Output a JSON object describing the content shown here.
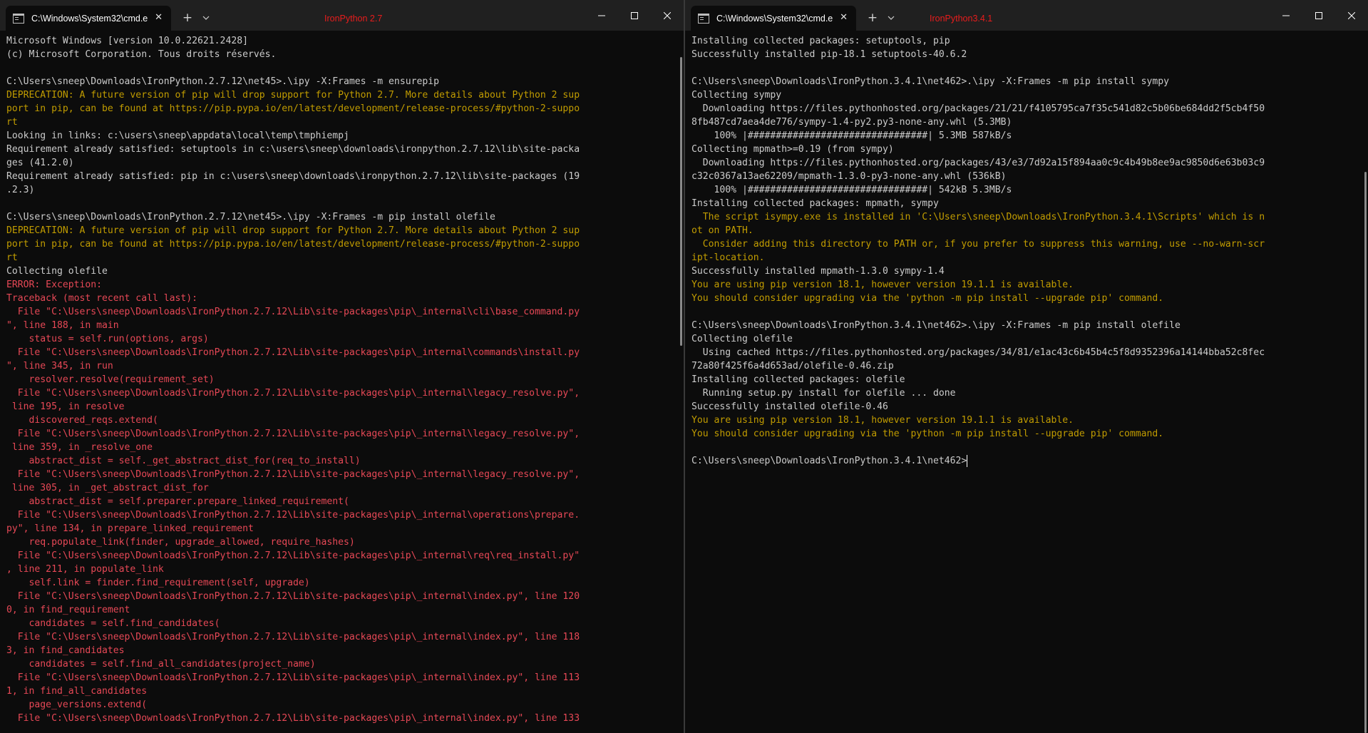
{
  "left_window": {
    "tab_title": "C:\\Windows\\System32\\cmd.e",
    "annotation": "IronPython 2.7",
    "lines": [
      {
        "t": "Microsoft Windows [version 10.0.22621.2428]",
        "c": "normal"
      },
      {
        "t": "(c) Microsoft Corporation. Tous droits réservés.",
        "c": "normal"
      },
      {
        "t": "",
        "c": "normal"
      },
      {
        "t": "C:\\Users\\sneep\\Downloads\\IronPython.2.7.12\\net45>.\\ipy -X:Frames -m ensurepip",
        "c": "normal"
      },
      {
        "t": "DEPRECATION: A future version of pip will drop support for Python 2.7. More details about Python 2 sup",
        "c": "warn"
      },
      {
        "t": "port in pip, can be found at https://pip.pypa.io/en/latest/development/release-process/#python-2-suppo",
        "c": "warn"
      },
      {
        "t": "rt",
        "c": "warn"
      },
      {
        "t": "Looking in links: c:\\users\\sneep\\appdata\\local\\temp\\tmphiempj",
        "c": "normal"
      },
      {
        "t": "Requirement already satisfied: setuptools in c:\\users\\sneep\\downloads\\ironpython.2.7.12\\lib\\site-packa",
        "c": "normal"
      },
      {
        "t": "ges (41.2.0)",
        "c": "normal"
      },
      {
        "t": "Requirement already satisfied: pip in c:\\users\\sneep\\downloads\\ironpython.2.7.12\\lib\\site-packages (19",
        "c": "normal"
      },
      {
        "t": ".2.3)",
        "c": "normal"
      },
      {
        "t": "",
        "c": "normal"
      },
      {
        "t": "C:\\Users\\sneep\\Downloads\\IronPython.2.7.12\\net45>.\\ipy -X:Frames -m pip install olefile",
        "c": "normal"
      },
      {
        "t": "DEPRECATION: A future version of pip will drop support for Python 2.7. More details about Python 2 sup",
        "c": "warn"
      },
      {
        "t": "port in pip, can be found at https://pip.pypa.io/en/latest/development/release-process/#python-2-suppo",
        "c": "warn"
      },
      {
        "t": "rt",
        "c": "warn"
      },
      {
        "t": "Collecting olefile",
        "c": "normal"
      },
      {
        "t": "ERROR: Exception:",
        "c": "err"
      },
      {
        "t": "Traceback (most recent call last):",
        "c": "err"
      },
      {
        "t": "  File \"C:\\Users\\sneep\\Downloads\\IronPython.2.7.12\\Lib\\site-packages\\pip\\_internal\\cli\\base_command.py",
        "c": "err"
      },
      {
        "t": "\", line 188, in main",
        "c": "err"
      },
      {
        "t": "    status = self.run(options, args)",
        "c": "err"
      },
      {
        "t": "  File \"C:\\Users\\sneep\\Downloads\\IronPython.2.7.12\\Lib\\site-packages\\pip\\_internal\\commands\\install.py",
        "c": "err"
      },
      {
        "t": "\", line 345, in run",
        "c": "err"
      },
      {
        "t": "    resolver.resolve(requirement_set)",
        "c": "err"
      },
      {
        "t": "  File \"C:\\Users\\sneep\\Downloads\\IronPython.2.7.12\\Lib\\site-packages\\pip\\_internal\\legacy_resolve.py\",",
        "c": "err"
      },
      {
        "t": " line 195, in resolve",
        "c": "err"
      },
      {
        "t": "    discovered_reqs.extend(",
        "c": "err"
      },
      {
        "t": "  File \"C:\\Users\\sneep\\Downloads\\IronPython.2.7.12\\Lib\\site-packages\\pip\\_internal\\legacy_resolve.py\",",
        "c": "err"
      },
      {
        "t": " line 359, in _resolve_one",
        "c": "err"
      },
      {
        "t": "    abstract_dist = self._get_abstract_dist_for(req_to_install)",
        "c": "err"
      },
      {
        "t": "  File \"C:\\Users\\sneep\\Downloads\\IronPython.2.7.12\\Lib\\site-packages\\pip\\_internal\\legacy_resolve.py\",",
        "c": "err"
      },
      {
        "t": " line 305, in _get_abstract_dist_for",
        "c": "err"
      },
      {
        "t": "    abstract_dist = self.preparer.prepare_linked_requirement(",
        "c": "err"
      },
      {
        "t": "  File \"C:\\Users\\sneep\\Downloads\\IronPython.2.7.12\\Lib\\site-packages\\pip\\_internal\\operations\\prepare.",
        "c": "err"
      },
      {
        "t": "py\", line 134, in prepare_linked_requirement",
        "c": "err"
      },
      {
        "t": "    req.populate_link(finder, upgrade_allowed, require_hashes)",
        "c": "err"
      },
      {
        "t": "  File \"C:\\Users\\sneep\\Downloads\\IronPython.2.7.12\\Lib\\site-packages\\pip\\_internal\\req\\req_install.py\"",
        "c": "err"
      },
      {
        "t": ", line 211, in populate_link",
        "c": "err"
      },
      {
        "t": "    self.link = finder.find_requirement(self, upgrade)",
        "c": "err"
      },
      {
        "t": "  File \"C:\\Users\\sneep\\Downloads\\IronPython.2.7.12\\Lib\\site-packages\\pip\\_internal\\index.py\", line 120",
        "c": "err"
      },
      {
        "t": "0, in find_requirement",
        "c": "err"
      },
      {
        "t": "    candidates = self.find_candidates(",
        "c": "err"
      },
      {
        "t": "  File \"C:\\Users\\sneep\\Downloads\\IronPython.2.7.12\\Lib\\site-packages\\pip\\_internal\\index.py\", line 118",
        "c": "err"
      },
      {
        "t": "3, in find_candidates",
        "c": "err"
      },
      {
        "t": "    candidates = self.find_all_candidates(project_name)",
        "c": "err"
      },
      {
        "t": "  File \"C:\\Users\\sneep\\Downloads\\IronPython.2.7.12\\Lib\\site-packages\\pip\\_internal\\index.py\", line 113",
        "c": "err"
      },
      {
        "t": "1, in find_all_candidates",
        "c": "err"
      },
      {
        "t": "    page_versions.extend(",
        "c": "err"
      },
      {
        "t": "  File \"C:\\Users\\sneep\\Downloads\\IronPython.2.7.12\\Lib\\site-packages\\pip\\_internal\\index.py\", line 133",
        "c": "err"
      }
    ]
  },
  "right_window": {
    "tab_title": "C:\\Windows\\System32\\cmd.e",
    "annotation": "IronPython3.4.1",
    "lines": [
      {
        "t": "Installing collected packages: setuptools, pip",
        "c": "normal"
      },
      {
        "t": "Successfully installed pip-18.1 setuptools-40.6.2",
        "c": "normal"
      },
      {
        "t": "",
        "c": "normal"
      },
      {
        "t": "C:\\Users\\sneep\\Downloads\\IronPython.3.4.1\\net462>.\\ipy -X:Frames -m pip install sympy",
        "c": "normal"
      },
      {
        "t": "Collecting sympy",
        "c": "normal"
      },
      {
        "t": "  Downloading https://files.pythonhosted.org/packages/21/21/f4105795ca7f35c541d82c5b06be684dd2f5cb4f50",
        "c": "normal"
      },
      {
        "t": "8fb487cd7aea4de776/sympy-1.4-py2.py3-none-any.whl (5.3MB)",
        "c": "normal"
      },
      {
        "t": "    100% |################################| 5.3MB 587kB/s",
        "c": "normal"
      },
      {
        "t": "Collecting mpmath>=0.19 (from sympy)",
        "c": "normal"
      },
      {
        "t": "  Downloading https://files.pythonhosted.org/packages/43/e3/7d92a15f894aa0c9c4b49b8ee9ac9850d6e63b03c9",
        "c": "normal"
      },
      {
        "t": "c32c0367a13ae62209/mpmath-1.3.0-py3-none-any.whl (536kB)",
        "c": "normal"
      },
      {
        "t": "    100% |################################| 542kB 5.3MB/s",
        "c": "normal"
      },
      {
        "t": "Installing collected packages: mpmath, sympy",
        "c": "normal"
      },
      {
        "t": "  The script isympy.exe is installed in 'C:\\Users\\sneep\\Downloads\\IronPython.3.4.1\\Scripts' which is n",
        "c": "warn"
      },
      {
        "t": "ot on PATH.",
        "c": "warn"
      },
      {
        "t": "  Consider adding this directory to PATH or, if you prefer to suppress this warning, use --no-warn-scr",
        "c": "warn"
      },
      {
        "t": "ipt-location.",
        "c": "warn"
      },
      {
        "t": "Successfully installed mpmath-1.3.0 sympy-1.4",
        "c": "normal"
      },
      {
        "t": "You are using pip version 18.1, however version 19.1.1 is available.",
        "c": "warn"
      },
      {
        "t": "You should consider upgrading via the 'python -m pip install --upgrade pip' command.",
        "c": "warn"
      },
      {
        "t": "",
        "c": "normal"
      },
      {
        "t": "C:\\Users\\sneep\\Downloads\\IronPython.3.4.1\\net462>.\\ipy -X:Frames -m pip install olefile",
        "c": "normal"
      },
      {
        "t": "Collecting olefile",
        "c": "normal"
      },
      {
        "t": "  Using cached https://files.pythonhosted.org/packages/34/81/e1ac43c6b45b4c5f8d9352396a14144bba52c8fec",
        "c": "normal"
      },
      {
        "t": "72a80f425f6a4d653ad/olefile-0.46.zip",
        "c": "normal"
      },
      {
        "t": "Installing collected packages: olefile",
        "c": "normal"
      },
      {
        "t": "  Running setup.py install for olefile ... done",
        "c": "normal"
      },
      {
        "t": "Successfully installed olefile-0.46",
        "c": "normal"
      },
      {
        "t": "You are using pip version 18.1, however version 19.1.1 is available.",
        "c": "warn"
      },
      {
        "t": "You should consider upgrading via the 'python -m pip install --upgrade pip' command.",
        "c": "warn"
      },
      {
        "t": "",
        "c": "normal"
      }
    ],
    "prompt": "C:\\Users\\sneep\\Downloads\\IronPython.3.4.1\\net462>"
  },
  "icons": {
    "tab": "terminal-app-icon",
    "close": "close-icon",
    "new_tab": "plus-icon",
    "dropdown": "chevron-down-icon",
    "minimize": "minimize-icon",
    "maximize": "maximize-icon"
  },
  "colors": {
    "background": "#0c0c0c",
    "titlebar": "#202020",
    "text": "#cccccc",
    "warning": "#c19c00",
    "error": "#e74856",
    "annotation": "#e81c1c"
  }
}
